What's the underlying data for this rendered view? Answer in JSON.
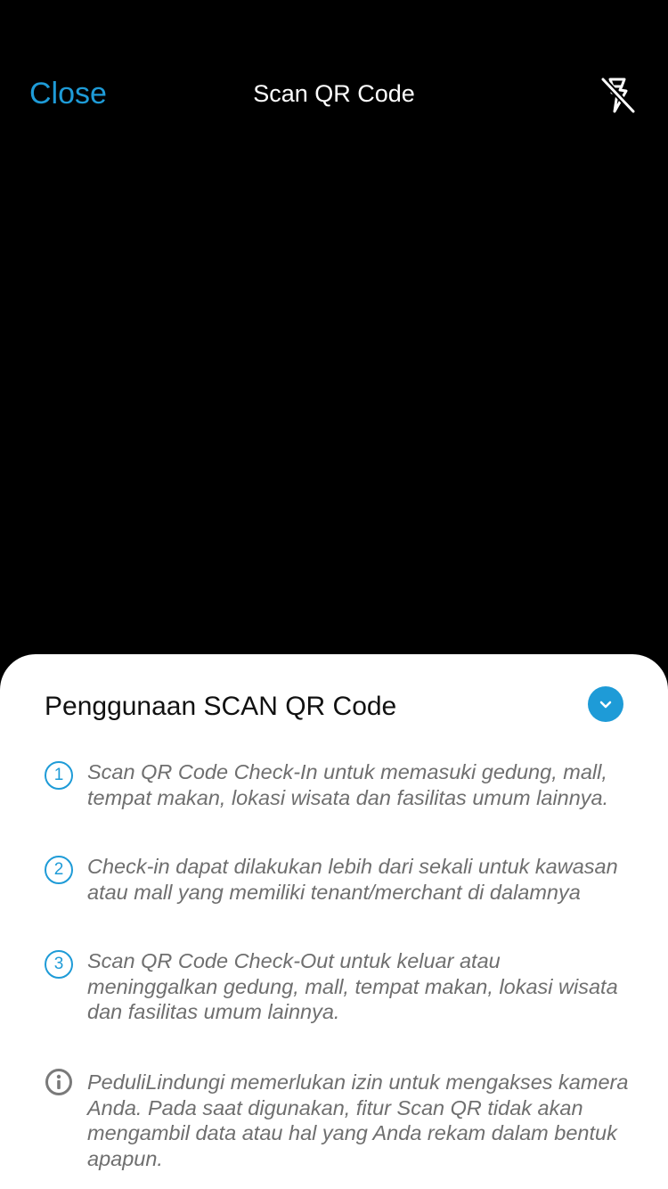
{
  "header": {
    "close_label": "Close",
    "title": "Scan QR Code",
    "flash_icon": "flash-off-icon"
  },
  "sheet": {
    "title": "Penggunaan SCAN QR Code",
    "collapse_icon": "chevron-down-icon",
    "steps": [
      {
        "number": "1",
        "text": "Scan QR Code Check-In untuk memasuki gedung, mall, tempat makan, lokasi wisata dan fasilitas umum lainnya."
      },
      {
        "number": "2",
        "text": "Check-in dapat dilakukan lebih dari sekali untuk kawasan atau mall yang memiliki tenant/merchant di dalamnya"
      },
      {
        "number": "3",
        "text": "Scan QR Code Check-Out untuk keluar atau meninggalkan gedung, mall, tempat makan, lokasi wisata dan fasilitas umum lainnya."
      }
    ],
    "info_icon": "info-icon",
    "info_text": "PeduliLindungi memerlukan izin untuk mengakses kamera Anda. Pada saat digunakan, fitur Scan QR tidak akan mengambil data atau hal yang Anda rekam dalam bentuk apapun."
  },
  "colors": {
    "accent": "#1E9BD7",
    "background": "#000000",
    "sheet": "#FFFFFF",
    "muted_text": "#6F6F6F"
  }
}
